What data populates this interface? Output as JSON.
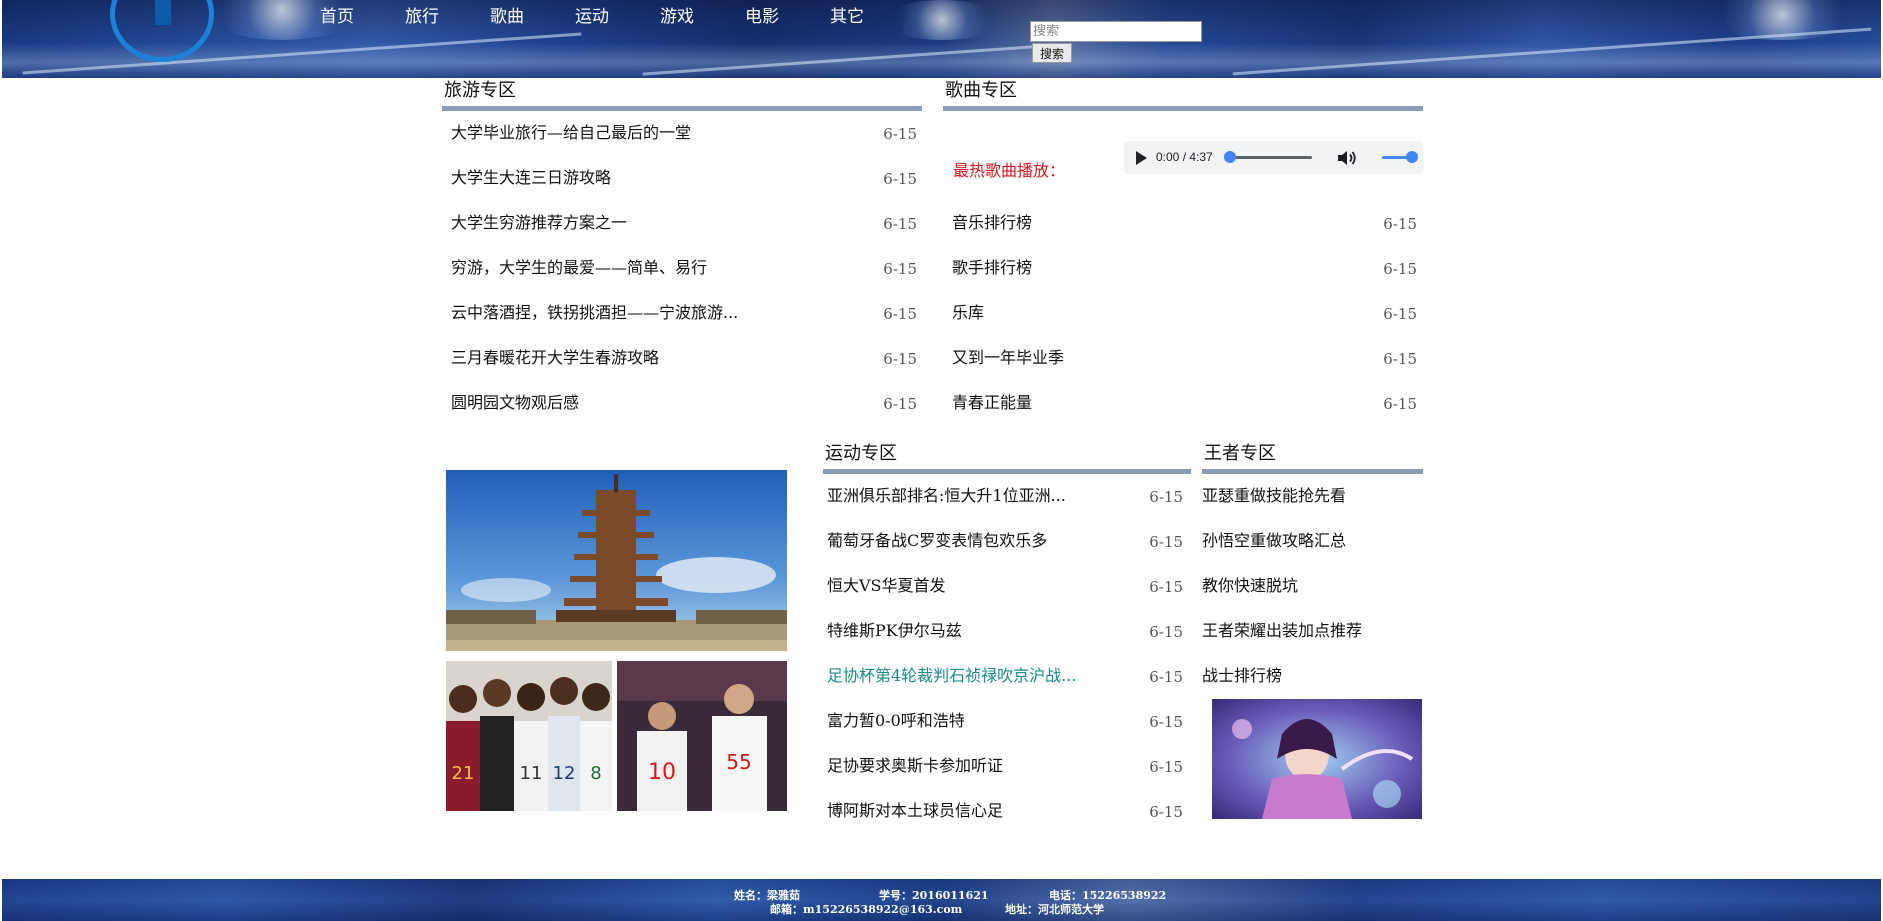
{
  "nav": {
    "items": [
      "首页",
      "旅行",
      "歌曲",
      "运动",
      "游戏",
      "电影",
      "其它"
    ]
  },
  "search": {
    "placeholder": "搜索",
    "button_label": "搜索"
  },
  "travel": {
    "title": "旅游专区",
    "items": [
      {
        "text": "大学毕业旅行—给自己最后的一堂",
        "date": "6-15"
      },
      {
        "text": "大学生大连三日游攻略",
        "date": "6-15"
      },
      {
        "text": "大学生穷游推荐方案之一",
        "date": "6-15"
      },
      {
        "text": "穷游，大学生的最爱——简单、易行",
        "date": "6-15"
      },
      {
        "text": "云中落酒捏，铁拐挑酒担——宁波旅游...",
        "date": "6-15"
      },
      {
        "text": "三月春暖花开大学生春游攻略",
        "date": "6-15"
      },
      {
        "text": "圆明园文物观后感",
        "date": "6-15"
      }
    ]
  },
  "music": {
    "title": "歌曲专区",
    "hot_label": "最热歌曲播放：",
    "player": {
      "time": "0:00 / 4:37",
      "progress": 0,
      "volume": 1
    },
    "items": [
      {
        "text": "音乐排行榜",
        "date": "6-15"
      },
      {
        "text": "歌手排行榜",
        "date": "6-15"
      },
      {
        "text": "乐库",
        "date": "6-15"
      },
      {
        "text": "又到一年毕业季",
        "date": "6-15"
      },
      {
        "text": "青春正能量",
        "date": "6-15"
      }
    ]
  },
  "sports": {
    "title": "运动专区",
    "items": [
      {
        "text": "亚洲俱乐部排名:恒大升1位亚洲...",
        "date": "6-15"
      },
      {
        "text": "葡萄牙备战C罗变表情包欢乐多",
        "date": "6-15"
      },
      {
        "text": "恒大VS华夏首发",
        "date": "6-15"
      },
      {
        "text": "特维斯PK伊尔马兹",
        "date": "6-15"
      },
      {
        "text": "足协杯第4轮裁判石祯禄吹京沪战...",
        "date": "6-15"
      },
      {
        "text": "富力暂0-0呼和浩特",
        "date": "6-15"
      },
      {
        "text": "足协要求奥斯卡参加听证",
        "date": "6-15"
      },
      {
        "text": "博阿斯对本土球员信心足",
        "date": "6-15"
      }
    ]
  },
  "king": {
    "title": "王者专区",
    "items": [
      {
        "text": "亚瑟重做技能抢先看"
      },
      {
        "text": "孙悟空重做攻略汇总"
      },
      {
        "text": "教你快速脱坑"
      },
      {
        "text": "王者荣耀出装加点推荐"
      },
      {
        "text": "战士排行榜"
      }
    ]
  },
  "footer": {
    "name": "姓名：梁雅茹",
    "student_id": "学号：2016011621",
    "phone": "电话：15226538922",
    "email": "邮箱：m15226538922@163.com",
    "address": "地址：河北师范大学"
  },
  "colors": {
    "section_rule": "#8a9bb8",
    "hot_label": "#d8141e",
    "highlight_link": "#168a8a",
    "header_blue": "#1e3b7e"
  }
}
